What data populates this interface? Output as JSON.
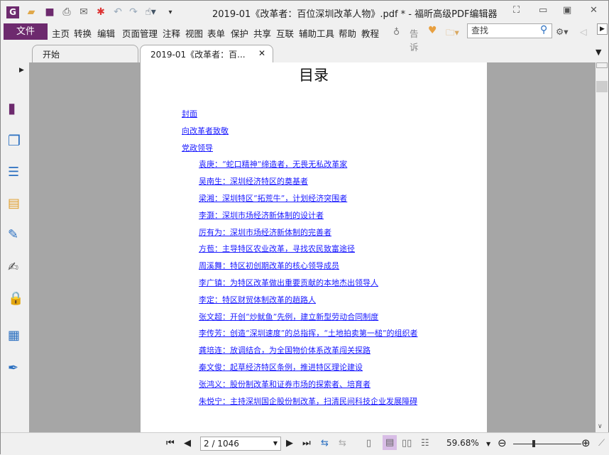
{
  "window": {
    "title": "2019-01《改革者：百位深圳改革人物》.pdf * - 福昕高级PDF编辑器"
  },
  "menu": {
    "file": "文件",
    "items": [
      "主页",
      "转换",
      "编辑",
      "页面管理",
      "注释",
      "视图",
      "表单",
      "保护",
      "共享",
      "互联",
      "辅助工具",
      "帮助",
      "教程"
    ],
    "tell": "告诉",
    "search_placeholder": "查找"
  },
  "tabs": [
    {
      "label": "开始"
    },
    {
      "label": "2019-01《改革者：百..."
    }
  ],
  "page": {
    "title": "目录",
    "toc": [
      {
        "text": "封面",
        "level": 1
      },
      {
        "text": "向改革者致敬",
        "level": 1
      },
      {
        "text": "党政领导",
        "level": 1
      },
      {
        "text": "袁庚：“蛇口精神”缔造者，无畏无私改革家",
        "level": 2
      },
      {
        "text": "吴南生：深圳经济特区的奠基者",
        "level": 2
      },
      {
        "text": "梁湘：深圳特区“拓荒牛”，计划经济突围者",
        "level": 2
      },
      {
        "text": "李灏：深圳市场经济新体制的设计者",
        "level": 2
      },
      {
        "text": "厉有为：深圳市场经济新体制的完善者",
        "level": 2
      },
      {
        "text": "方苞：主导特区农业改革，寻找农民致富途径",
        "level": 2
      },
      {
        "text": "周溪舞：特区初创期改革的核心领导成员",
        "level": 2
      },
      {
        "text": "李广镇：为特区改革做出重要贡献的本地杰出领导人",
        "level": 2
      },
      {
        "text": "李定：特区财贸体制改革的趟路人",
        "level": 2
      },
      {
        "text": "张文超：开创“炒鱿鱼”先例，建立新型劳动合同制度",
        "level": 2
      },
      {
        "text": "李传芳：创造“深圳速度”的总指挥，“土地拍卖第一槌”的组织者",
        "level": 2
      },
      {
        "text": "龚培连：放调结合，为全国物价体系改革闯关探路",
        "level": 2
      },
      {
        "text": "秦文俊：起草经济特区条例，推进特区理论建设",
        "level": 2
      },
      {
        "text": "张鸿义：股份制改革和证券市场的探索者、培育者",
        "level": 2
      },
      {
        "text": "朱悦宁：主持深圳国企股份制改革，扫清民间科技企业发展障碍",
        "level": 2
      }
    ]
  },
  "status": {
    "page": "2 / 1046",
    "zoom": "59.68%",
    "zoom_slider_fraction": 0.3
  },
  "colors": {
    "accent": "#6d2a6e",
    "link": "#1a1aff",
    "doc_bg": "#a6a6a6"
  }
}
